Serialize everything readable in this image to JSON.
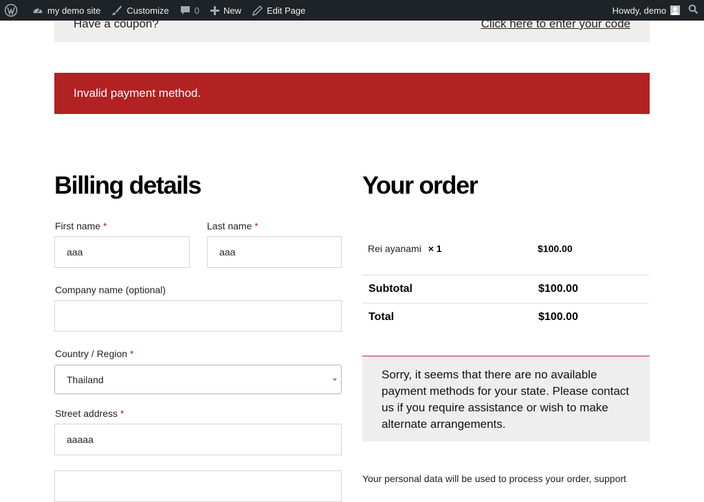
{
  "adminbar": {
    "site_name": "my demo site",
    "customize": "Customize",
    "comments_count": "0",
    "new": "New",
    "edit_page": "Edit Page",
    "howdy": "Howdy, demo"
  },
  "coupon": {
    "question": "Have a coupon?",
    "link": "Click here to enter your code"
  },
  "error": {
    "message": "Invalid payment method."
  },
  "billing": {
    "title": "Billing details",
    "first_name": {
      "label": "First name",
      "value": "aaa"
    },
    "last_name": {
      "label": "Last name",
      "value": "aaa"
    },
    "company": {
      "label": "Company name (optional)",
      "value": ""
    },
    "country": {
      "label": "Country / Region",
      "value": "Thailand"
    },
    "street": {
      "label": "Street address",
      "value": "aaaaa"
    },
    "required_mark": "*"
  },
  "order": {
    "title": "Your order",
    "item_name": "Rei ayanami",
    "item_qty": "× 1",
    "item_price": "$100.00",
    "subtotal_label": "Subtotal",
    "subtotal_value": "$100.00",
    "total_label": "Total",
    "total_value": "$100.00",
    "notice": "Sorry, it seems that there are no available payment methods for your state. Please contact us if you require assistance or wish to make alternate arrangements.",
    "privacy": "Your personal data will be used to process your order, support"
  },
  "colors": {
    "adminbar_bg": "#1d2327",
    "error_bg": "#b22222",
    "required": "#b22222",
    "notice_bg": "#eeeeee"
  }
}
